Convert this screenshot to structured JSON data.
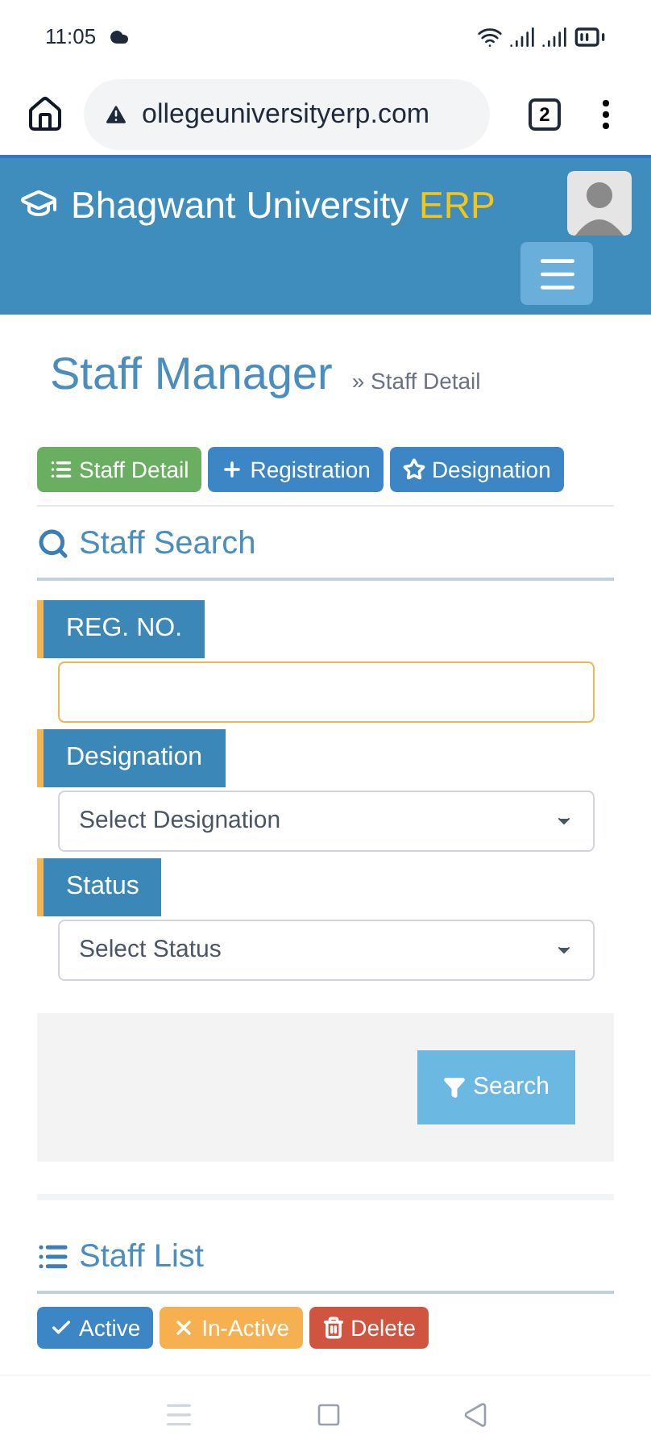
{
  "status_bar": {
    "time": "11:05"
  },
  "browser": {
    "url": "ollegeuniversityerp.com",
    "tab_count": "2"
  },
  "header": {
    "brand": "Bhagwant University",
    "brand_accent": "ERP"
  },
  "page": {
    "title": "Staff Manager",
    "breadcrumb": "» Staff Detail"
  },
  "nav_buttons": [
    {
      "label": "Staff Detail",
      "kind": "list",
      "selected": true
    },
    {
      "label": "Registration",
      "kind": "plus",
      "selected": false
    },
    {
      "label": "Designation",
      "kind": "star",
      "selected": false
    }
  ],
  "search_section": {
    "title": "Staff Search",
    "fields": [
      {
        "label": "REG. NO.",
        "kind": "text",
        "focused": true
      },
      {
        "label": "Designation",
        "kind": "select",
        "placeholder": "Select Designation",
        "focused": false
      },
      {
        "label": "Status",
        "kind": "select",
        "placeholder": "Select Status",
        "focused": false
      }
    ],
    "button": "Search"
  },
  "list_section": {
    "title": "Staff List",
    "actions": [
      {
        "label": "Active",
        "kind": "check",
        "color": "#3c86c6"
      },
      {
        "label": "In-Active",
        "kind": "cross",
        "color": "#f7b04f"
      },
      {
        "label": "Delete",
        "kind": "trash",
        "color": "#cf5540"
      }
    ]
  }
}
